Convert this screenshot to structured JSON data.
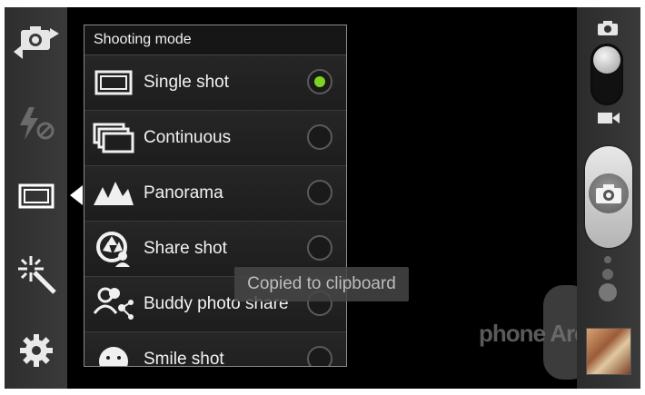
{
  "popup": {
    "title": "Shooting mode",
    "options": [
      {
        "label": "Single shot",
        "icon": "single-shot-icon",
        "selected": true
      },
      {
        "label": "Continuous",
        "icon": "continuous-icon",
        "selected": false
      },
      {
        "label": "Panorama",
        "icon": "panorama-icon",
        "selected": false
      },
      {
        "label": "Share shot",
        "icon": "share-shot-icon",
        "selected": false
      },
      {
        "label": "Buddy photo share",
        "icon": "buddy-photo-share-icon",
        "selected": false
      },
      {
        "label": "Smile shot",
        "icon": "smile-shot-icon",
        "selected": false
      }
    ]
  },
  "toast": {
    "text": "Copied to clipboard"
  },
  "watermark": {
    "text": "phone Arena"
  },
  "left_toolbar": [
    "switch-camera-icon",
    "flash-off-icon",
    "shooting-mode-icon",
    "effects-icon",
    "settings-icon"
  ],
  "colors": {
    "accent": "#7ed321",
    "background": "#000000",
    "popup": "#1e1e1e"
  }
}
